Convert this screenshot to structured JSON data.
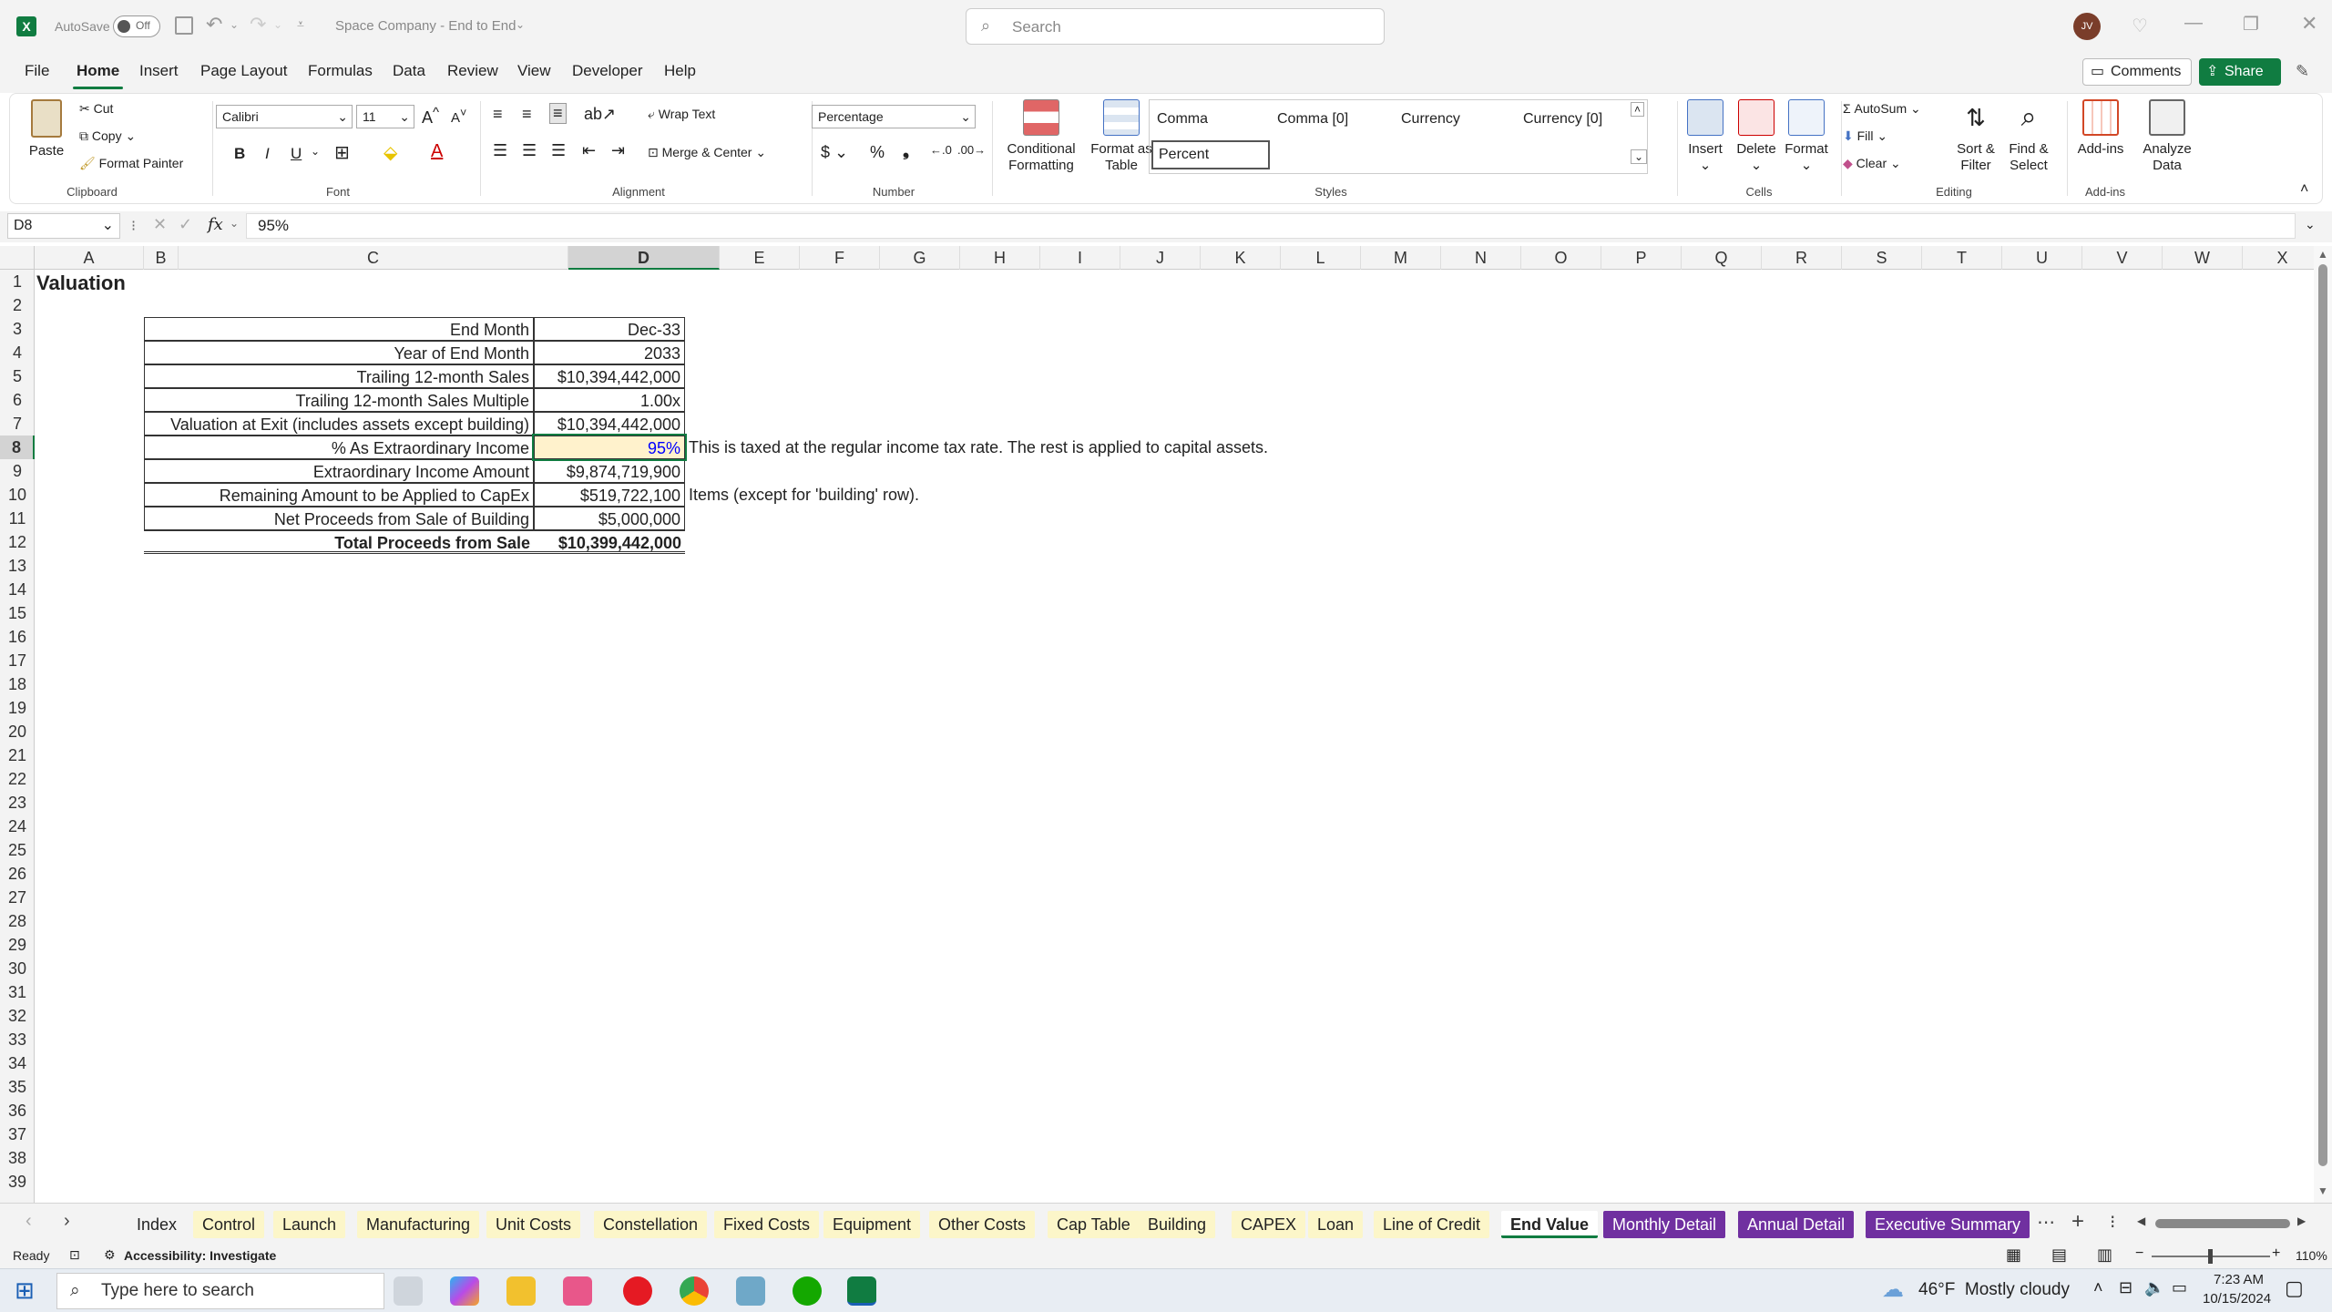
{
  "app": {
    "autosave_label": "AutoSave",
    "autosave_state": "Off",
    "file_title": "Space Company - End to End",
    "search_placeholder": "Search",
    "user_initials": "JV"
  },
  "menu_tabs": [
    "File",
    "Home",
    "Insert",
    "Page Layout",
    "Formulas",
    "Data",
    "Review",
    "View",
    "Developer",
    "Help"
  ],
  "active_menu_tab": "Home",
  "comments_label": "Comments",
  "share_label": "Share",
  "ribbon": {
    "clipboard": {
      "paste": "Paste",
      "cut": "Cut",
      "copy": "Copy",
      "format_painter": "Format Painter",
      "group": "Clipboard"
    },
    "font": {
      "name": "Calibri",
      "size": "11",
      "group": "Font",
      "bold": "B",
      "italic": "I",
      "underline": "U"
    },
    "alignment": {
      "wrap_text": "Wrap Text",
      "merge_center": "Merge & Center",
      "group": "Alignment"
    },
    "number": {
      "format": "Percentage",
      "group": "Number"
    },
    "styles": {
      "conditional": "Conditional Formatting",
      "format_table": "Format as Table",
      "items": [
        "Comma",
        "Comma [0]",
        "Currency",
        "Currency [0]",
        "Percent"
      ],
      "group": "Styles"
    },
    "cells": {
      "insert": "Insert",
      "delete": "Delete",
      "format": "Format",
      "group": "Cells"
    },
    "editing": {
      "autosum": "AutoSum",
      "fill": "Fill",
      "clear": "Clear",
      "sort_filter": "Sort & Filter",
      "find_select": "Find & Select",
      "group": "Editing"
    },
    "addins": {
      "addins": "Add-ins",
      "analyze": "Analyze Data",
      "group": "Add-ins"
    }
  },
  "formula_bar": {
    "name_box": "D8",
    "fx": "fx",
    "value": "95%"
  },
  "columns": [
    "A",
    "B",
    "C",
    "D",
    "E",
    "F",
    "G",
    "H",
    "I",
    "J",
    "K",
    "L",
    "M",
    "N",
    "O",
    "P",
    "Q",
    "R",
    "S",
    "T",
    "U",
    "V",
    "W",
    "X"
  ],
  "row_count": 39,
  "sheet": {
    "title": "Valuation",
    "rows": [
      {
        "label": "End Month",
        "value": "Dec-33"
      },
      {
        "label": "Year of End Month",
        "value": "2033"
      },
      {
        "label": "Trailing 12-month Sales",
        "value": "$10,394,442,000"
      },
      {
        "label": "Trailing 12-month Sales Multiple",
        "value": "1.00x"
      },
      {
        "label": "Valuation at Exit (includes assets except building)",
        "value": "$10,394,442,000"
      },
      {
        "label": "% As Extraordinary Income",
        "value": "95%"
      },
      {
        "label": "Extraordinary Income Amount",
        "value": "$9,874,719,900"
      },
      {
        "label": "Remaining Amount to be Applied to CapEx",
        "value": "$519,722,100"
      },
      {
        "label": "Net Proceeds from Sale of Building",
        "value": "$5,000,000"
      },
      {
        "label": "Total Proceeds from Sale",
        "value": "$10,399,442,000"
      }
    ],
    "note_row8": "This is taxed at the regular income tax rate. The rest is applied to capital assets.",
    "note_row10": "Items (except for 'building' row)."
  },
  "sheet_tabs": [
    "Index",
    "Control",
    "Launch",
    "Manufacturing",
    "Unit Costs",
    "Constellation",
    "Fixed Costs",
    "Equipment",
    "Other Costs",
    "Cap Table",
    "Building",
    "CAPEX",
    "Loan",
    "Line of Credit",
    "End Value",
    "Monthly Detail",
    "Annual Detail",
    "Executive Summary"
  ],
  "active_sheet": "End Value",
  "status": {
    "ready": "Ready",
    "accessibility": "Accessibility: Investigate",
    "zoom": "110%"
  },
  "taskbar": {
    "search_placeholder": "Type here to search",
    "weather": "46°F  Mostly cloudy",
    "time": "7:23 AM",
    "date": "10/15/2024"
  },
  "colors": {
    "excel_green": "#107c41",
    "tab_yellow": "#fcf6c9",
    "tab_purple": "#7030a0",
    "input_blue": "#0000ff",
    "highlight": "#fff2cc"
  }
}
